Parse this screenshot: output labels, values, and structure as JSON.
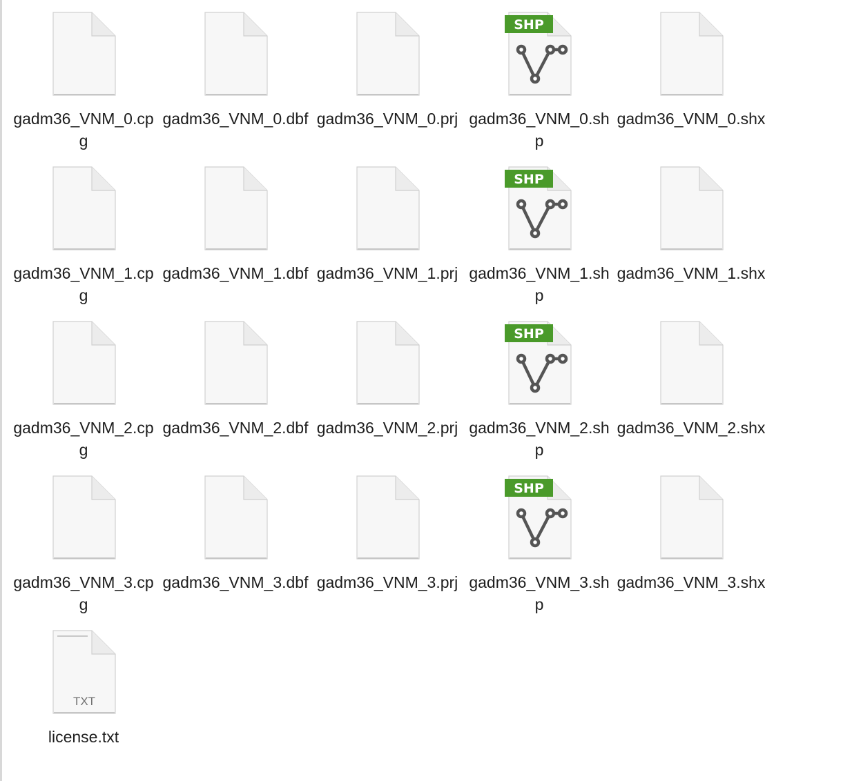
{
  "files": [
    {
      "name": "gadm36_VNM_0.cpg",
      "icon": "blank-document-icon"
    },
    {
      "name": "gadm36_VNM_0.dbf",
      "icon": "blank-document-icon"
    },
    {
      "name": "gadm36_VNM_0.prj",
      "icon": "blank-document-icon"
    },
    {
      "name": "gadm36_VNM_0.shp",
      "icon": "shapefile-icon",
      "badge": "SHP"
    },
    {
      "name": "gadm36_VNM_0.shx",
      "icon": "blank-document-icon"
    },
    {
      "name": "gadm36_VNM_1.cpg",
      "icon": "blank-document-icon"
    },
    {
      "name": "gadm36_VNM_1.dbf",
      "icon": "blank-document-icon"
    },
    {
      "name": "gadm36_VNM_1.prj",
      "icon": "blank-document-icon"
    },
    {
      "name": "gadm36_VNM_1.shp",
      "icon": "shapefile-icon",
      "badge": "SHP"
    },
    {
      "name": "gadm36_VNM_1.shx",
      "icon": "blank-document-icon"
    },
    {
      "name": "gadm36_VNM_2.cpg",
      "icon": "blank-document-icon"
    },
    {
      "name": "gadm36_VNM_2.dbf",
      "icon": "blank-document-icon"
    },
    {
      "name": "gadm36_VNM_2.prj",
      "icon": "blank-document-icon"
    },
    {
      "name": "gadm36_VNM_2.shp",
      "icon": "shapefile-icon",
      "badge": "SHP"
    },
    {
      "name": "gadm36_VNM_2.shx",
      "icon": "blank-document-icon"
    },
    {
      "name": "gadm36_VNM_3.cpg",
      "icon": "blank-document-icon"
    },
    {
      "name": "gadm36_VNM_3.dbf",
      "icon": "blank-document-icon"
    },
    {
      "name": "gadm36_VNM_3.prj",
      "icon": "blank-document-icon"
    },
    {
      "name": "gadm36_VNM_3.shp",
      "icon": "shapefile-icon",
      "badge": "SHP"
    },
    {
      "name": "gadm36_VNM_3.shx",
      "icon": "blank-document-icon"
    },
    {
      "name": "license.txt",
      "icon": "text-document-icon",
      "badge": "TXT"
    }
  ],
  "colors": {
    "shp_badge": "#4a9a2a",
    "shp_glyph": "#555555",
    "page_fill": "#f7f7f7",
    "page_edge": "#d0d0d0",
    "label_text": "#1d1d1d"
  }
}
